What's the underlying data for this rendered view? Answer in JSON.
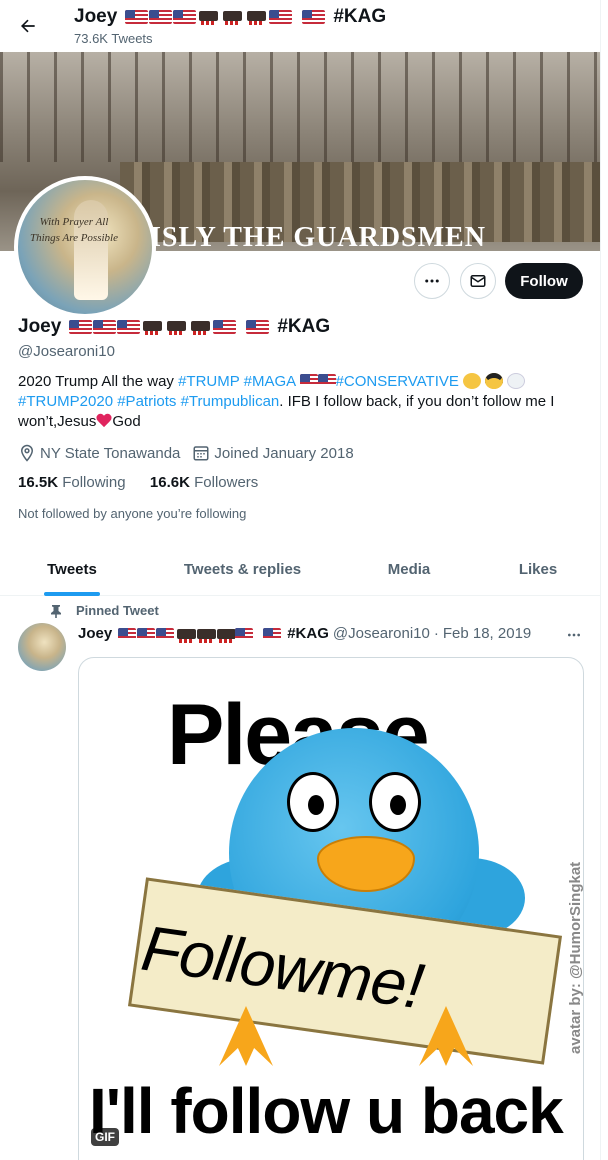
{
  "topbar": {
    "name": "Joey",
    "hashtag": "#KAG",
    "tweet_count": "73.6K Tweets"
  },
  "banner": {
    "overlay_text": "ISLY THE GUARDSMEN"
  },
  "avatar": {
    "caption": "With Prayer All Things Are Possible"
  },
  "actions": {
    "follow_label": "Follow"
  },
  "profile": {
    "name": "Joey",
    "hashtag": "#KAG",
    "handle": "@Josearoni10",
    "bio": {
      "prefix": "2020 Trump All the way ",
      "tags1": [
        "#TRUMP",
        "#MAGA"
      ],
      "tag_conservative": "#CONSERVATIVE",
      "tags2": [
        "#TRUMP2020",
        "#Patriots",
        "#Trumpublican"
      ],
      "after_tags": ". IFB I follow back, if you don’t follow me I won’t,Jesus",
      "after_heart": "God"
    },
    "location": "NY State Tonawanda",
    "joined": "Joined January 2018",
    "following_count": "16.5K",
    "following_label": "Following",
    "followers_count": "16.6K",
    "followers_label": "Followers",
    "not_followed": "Not followed by anyone you’re following"
  },
  "tabs": [
    "Tweets",
    "Tweets & replies",
    "Media",
    "Likes"
  ],
  "active_tab": "Tweets",
  "tweet": {
    "pinned_label": "Pinned Tweet",
    "name": "Joey",
    "hashtag": "#KAG",
    "handle": "@Josearoni10",
    "separator": "·",
    "date": "Feb 18, 2019",
    "gif": {
      "line1": "Please",
      "sign": "Followme!",
      "line2": "I'll follow u back",
      "watermark": "avatar by: @HumorSingkat",
      "badge": "GIF"
    }
  },
  "colors": {
    "accent": "#1d9bf0",
    "text": "#0f1419",
    "muted": "#536471"
  }
}
